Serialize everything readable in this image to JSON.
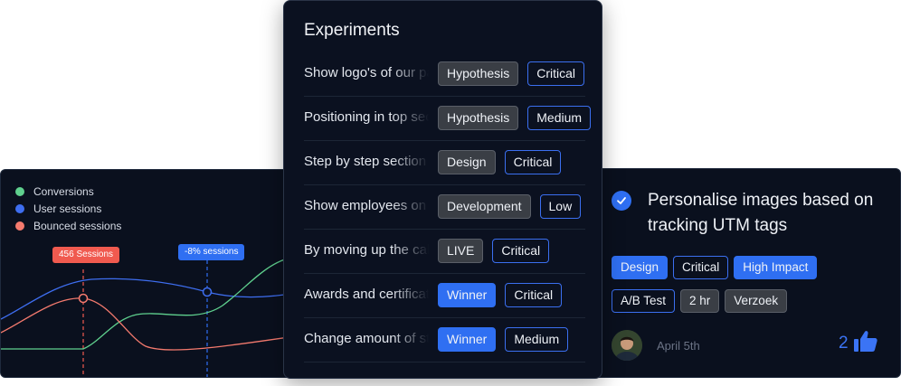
{
  "chart": {
    "legend": [
      {
        "label": "Conversions",
        "color": "#5fd08e"
      },
      {
        "label": "User sessions",
        "color": "#3e6ef0"
      },
      {
        "label": "Bounced sessions",
        "color": "#f47a6e"
      }
    ],
    "tooltip_sessions": "456 Sessions",
    "tooltip_change": "-8% sessions",
    "colors": {
      "conversions": "#5fd08e",
      "user_sessions": "#3e6ef0",
      "bounced": "#f47a6e",
      "tooltip_red": "#f05a4f",
      "tooltip_blue": "#2f6ff2"
    }
  },
  "experiments": {
    "title": "Experiments",
    "rows": [
      {
        "name": "Show logo's of our partners",
        "tags": [
          {
            "label": "Hypothesis",
            "style": "grey"
          },
          {
            "label": "Critical",
            "style": "outline"
          }
        ]
      },
      {
        "name": "Positioning in top section",
        "tags": [
          {
            "label": "Hypothesis",
            "style": "grey"
          },
          {
            "label": "Medium",
            "style": "outline"
          }
        ]
      },
      {
        "name": "Step by step section",
        "tags": [
          {
            "label": "Design",
            "style": "grey"
          },
          {
            "label": "Critical",
            "style": "outline"
          }
        ]
      },
      {
        "name": "Show employees on page",
        "tags": [
          {
            "label": "Development",
            "style": "grey"
          },
          {
            "label": "Low",
            "style": "outline"
          }
        ]
      },
      {
        "name": "By moving up the call to action",
        "tags": [
          {
            "label": "LIVE",
            "style": "grey"
          },
          {
            "label": "Critical",
            "style": "outline"
          }
        ]
      },
      {
        "name": "Awards and certificates",
        "tags": [
          {
            "label": "Winner",
            "style": "blue"
          },
          {
            "label": "Critical",
            "style": "outline"
          }
        ]
      },
      {
        "name": "Change amount of steps",
        "tags": [
          {
            "label": "Winner",
            "style": "blue"
          },
          {
            "label": "Medium",
            "style": "outline"
          }
        ]
      }
    ]
  },
  "card": {
    "title": "Personalise images based on tracking UTM tags",
    "tags_row1": [
      {
        "label": "Design",
        "style": "blue"
      },
      {
        "label": "Critical",
        "style": "outline"
      },
      {
        "label": "High Impact",
        "style": "blue"
      }
    ],
    "tags_row2": [
      {
        "label": "A/B Test",
        "style": "outline"
      },
      {
        "label": "2 hr",
        "style": "grey"
      },
      {
        "label": "Verzoek",
        "style": "grey"
      }
    ],
    "date": "April 5th",
    "likes": "2",
    "icons": {
      "check": "check-icon",
      "like": "thumbs-up-icon"
    }
  }
}
